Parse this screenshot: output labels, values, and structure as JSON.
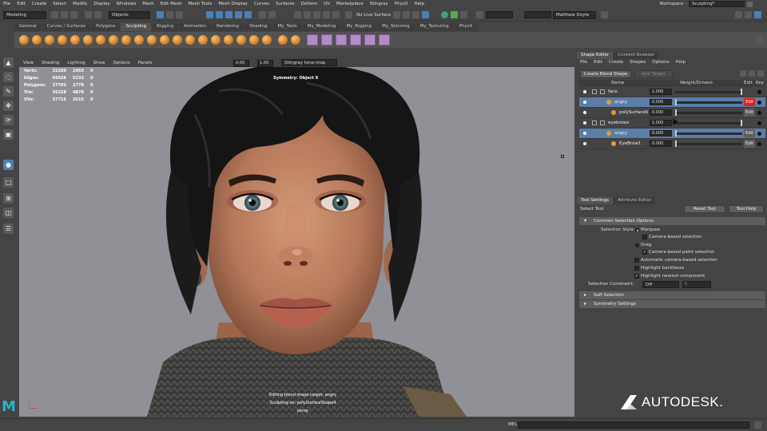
{
  "menubar": {
    "items": [
      "File",
      "Edit",
      "Create",
      "Select",
      "Modify",
      "Display",
      "Windows",
      "Mesh",
      "Edit Mesh",
      "Mesh Tools",
      "Mesh Display",
      "Curves",
      "Surfaces",
      "Deform",
      "UV",
      "Marketplace",
      "Stingray",
      "PhysX",
      "Help"
    ],
    "workspace_label": "Workspace :",
    "workspace_value": "Sculpting*"
  },
  "statusline": {
    "mode": "Modeling",
    "objects_label": "Objects",
    "live_surface": "No Live Surface",
    "user": "Matthew Doyle"
  },
  "shelf": {
    "tabs": [
      "General",
      "Curves / Surfaces",
      "Polygons",
      "Sculpting",
      "Rigging",
      "Animation",
      "Rendering",
      "Shading",
      "My_Tools",
      "My_Modeling",
      "My_Rigging",
      "My_Skinning",
      "My_Texturing",
      "PhysX"
    ],
    "active_tab": "Sculpting"
  },
  "viewport": {
    "menu": [
      "View",
      "Shading",
      "Lighting",
      "Show",
      "Options",
      "Panels"
    ],
    "field1": "0.00",
    "field2": "1.00",
    "colorspace": "Stingray tone-map",
    "hud": [
      {
        "label": "Verts:",
        "a": "32285",
        "b": "2455",
        "c": "0"
      },
      {
        "label": "Edges:",
        "a": "65626",
        "b": "5232",
        "c": "0"
      },
      {
        "label": "Polygons:",
        "a": "37702",
        "b": "2778",
        "c": "0"
      },
      {
        "label": "Tris:",
        "a": "56328",
        "b": "4878",
        "c": "0"
      },
      {
        "label": "UVs:",
        "a": "37715",
        "b": "2615",
        "c": "0"
      }
    ],
    "symmetry": "Symmetry: Object X",
    "status_line1": "Editing blend shape target: angry",
    "status_line2": "Sculpting on: polySurfaceShape4",
    "camera": "persp"
  },
  "shape_editor": {
    "tabs": [
      "Shape Editor",
      "Content Browser"
    ],
    "menu": [
      "File",
      "Edit",
      "Create",
      "Shapes",
      "Options",
      "Help"
    ],
    "create_btn": "Create Blend Shape",
    "add_target_btn": "Add Target",
    "col_name": "Name",
    "col_weight": "Weight/Drivers",
    "col_edit": "Edit",
    "col_key": "Key",
    "rows": [
      {
        "name": "face",
        "value": "1.000",
        "edit": "",
        "selected": false
      },
      {
        "name": "angry",
        "value": "0.000",
        "edit": "Edit",
        "selected": true
      },
      {
        "name": "polySurface6",
        "value": "0.000",
        "edit": "Edit",
        "selected": false
      },
      {
        "name": "eyebrows",
        "value": "1.000",
        "edit": "",
        "selected": false
      },
      {
        "name": "angry",
        "value": "0.000",
        "edit": "Edit",
        "selected": true
      },
      {
        "name": "EyeBrow1",
        "value": "0.000",
        "edit": "Edit",
        "selected": false
      }
    ]
  },
  "tool_settings": {
    "tabs": [
      "Tool Settings",
      "Attribute Editor"
    ],
    "tool_name": "Select Tool",
    "reset_btn": "Reset Tool",
    "help_btn": "Tool Help",
    "section_common": "Common Selection Options",
    "selection_style_label": "Selection Style:",
    "opt_marquee": "Marquee",
    "opt_camera_based": "Camera-based selection",
    "opt_drag": "Drag",
    "opt_camera_paint": "Camera-based paint selection",
    "opt_auto_camera": "Automatic camera-based selection",
    "opt_backfaces": "Highlight backfaces",
    "opt_nearest": "Highlight nearest component",
    "constraint_label": "Selection Constraint:",
    "constraint_value": "Off",
    "constraint_num": "5",
    "section_soft": "Soft Selection",
    "section_symmetry": "Symmetry Settings"
  },
  "bottom": {
    "mel": "MEL",
    "brand": "AUTODESK."
  }
}
